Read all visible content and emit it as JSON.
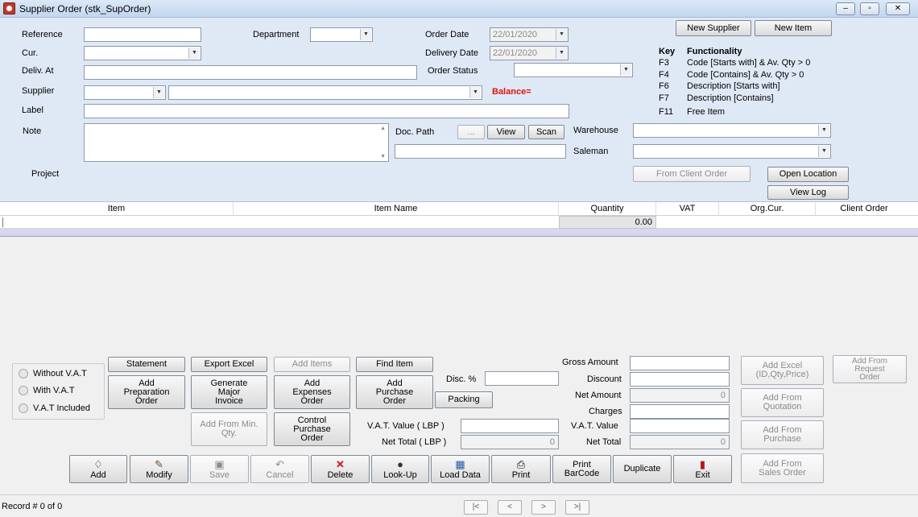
{
  "window": {
    "title": "Supplier Order  (stk_SupOrder)",
    "minimize_icon": "–",
    "restore_icon": "▫",
    "close_icon": "✕"
  },
  "header": {
    "reference_label": "Reference",
    "department_label": "Department",
    "order_date_label": "Order Date",
    "order_date_value": "22/01/2020",
    "cur_label": "Cur.",
    "delivery_date_label": "Delivery Date",
    "delivery_date_value": "22/01/2020",
    "deliv_at_label": "Deliv. At",
    "order_status_label": "Order Status",
    "supplier_label": "Supplier",
    "balance_label": "Balance=",
    "label_label": "Label",
    "note_label": "Note",
    "doc_path_label": "Doc. Path",
    "browse_label": "...",
    "view_label": "View",
    "scan_label": "Scan",
    "warehouse_label": "Warehouse",
    "saleman_label": "Saleman",
    "project_label": "Project",
    "new_supplier_label": "New Supplier",
    "new_item_label": "New Item",
    "from_client_order_label": "From Client Order",
    "open_location_label": "Open Location",
    "view_log_label": "View Log"
  },
  "key_panel": {
    "key_header": "Key",
    "functionality_header": "Functionality",
    "rows": [
      {
        "key": "F3",
        "desc": "Code [Starts with]  &  Av. Qty > 0"
      },
      {
        "key": "F4",
        "desc": "Code [Contains]    &  Av. Qty > 0"
      },
      {
        "key": "F6",
        "desc": "Description [Starts with]"
      },
      {
        "key": "F7",
        "desc": "Description [Contains]"
      },
      {
        "key": "F11",
        "desc": "Free Item"
      }
    ]
  },
  "grid": {
    "columns": [
      "Item",
      "Item Name",
      "Quantity",
      "VAT",
      "Org.Cur.",
      "Client Order"
    ],
    "rows": [
      {
        "quantity": "0.00"
      }
    ]
  },
  "vat_options": [
    "Without V.A.T",
    "With V.A.T",
    "V.A.T Included"
  ],
  "actions": {
    "statement": "Statement",
    "export_excel": "Export Excel",
    "add_items": "Add Items",
    "find_item": "Find Item",
    "add_preparation_order": "Add\nPreparation\nOrder",
    "generate_major_invoice": "Generate\nMajor\nInvoice",
    "add_expenses_order": "Add\nExpenses\nOrder",
    "add_purchase_order": "Add\nPurchase\nOrder",
    "add_from_min_qty": "Add From Min.\nQty.",
    "control_purchase_order": "Control\nPurchase\nOrder",
    "packing": "Packing",
    "add_excel": "Add Excel\n(ID,Qty,Price)",
    "add_from_request_order": "Add From\nRequest\nOrder",
    "add_from_quotation": "Add From\nQuotation",
    "add_from_purchase": "Add From\nPurchase",
    "add_from_sales_order": "Add From\nSales Order"
  },
  "totals": {
    "disc_label": "Disc. %",
    "vat_value_lbp_label": "V.A.T. Value ( LBP )",
    "net_total_lbp_label": "Net Total ( LBP )",
    "net_total_lbp_value": "0",
    "gross_amount_label": "Gross Amount",
    "discount_label": "Discount",
    "net_amount_label": "Net Amount",
    "net_amount_value": "0",
    "charges_label": "Charges",
    "vat_value_label": "V.A.T. Value",
    "net_total_label": "Net Total",
    "net_total_value": "0"
  },
  "toolbar": {
    "add": {
      "icon": "♢",
      "label": "Add"
    },
    "modify": {
      "icon": "✎",
      "label": "Modify"
    },
    "save": {
      "icon": "▣",
      "label": "Save"
    },
    "cancel": {
      "icon": "↶",
      "label": "Cancel"
    },
    "delete": {
      "icon": "✕",
      "label": "Delete"
    },
    "lookup": {
      "icon": "●",
      "label": "Look-Up"
    },
    "load_data": {
      "icon": "▦",
      "label": "Load Data"
    },
    "print": {
      "icon": "⎙",
      "label": "Print"
    },
    "print_barcode": {
      "label": "Print\nBarCode"
    },
    "duplicate": {
      "label": "Duplicate"
    },
    "exit": {
      "icon": "▮",
      "label": "Exit"
    }
  },
  "status": {
    "record_text": "Record #  0 of 0",
    "nav": [
      "|<",
      "<",
      ">",
      ">|"
    ]
  },
  "colors": {
    "balance": "#e01010",
    "form_bg": "#dfe9f5",
    "selection_row": "#d9d6ef"
  }
}
